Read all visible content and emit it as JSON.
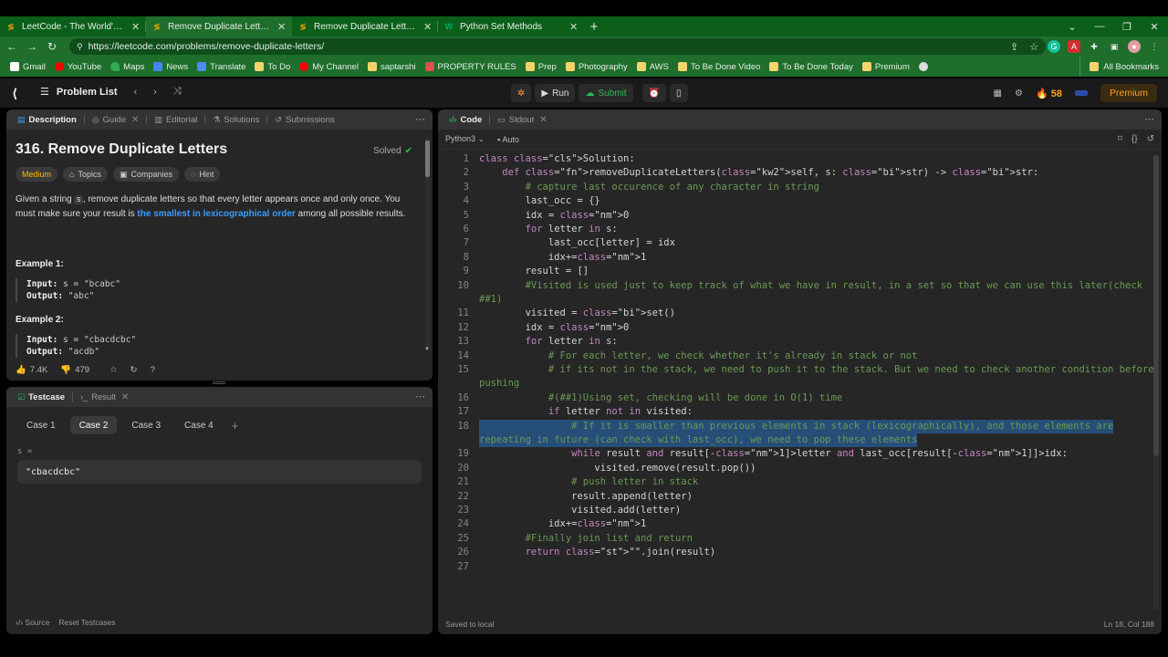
{
  "browser": {
    "tabs": [
      {
        "favicon": "leetcode-favicon",
        "title": "LeetCode - The World's Leading O",
        "active": false
      },
      {
        "favicon": "leetcode-favicon",
        "title": "Remove Duplicate Letters - LeetC",
        "active": true
      },
      {
        "favicon": "leetcode-favicon",
        "title": "Remove Duplicate Letters - LeetC",
        "active": false
      },
      {
        "favicon": "w3schools-favicon",
        "title": "Python Set Methods",
        "active": false
      }
    ],
    "url": "https://leetcode.com/problems/remove-duplicate-letters/",
    "bookmarks": [
      "Gmail",
      "YouTube",
      "Maps",
      "News",
      "Translate",
      "To Do",
      "My Channel",
      "saptarshi",
      "PROPERTY RULES",
      "Prep",
      "Photography",
      "AWS",
      "To Be Done Video",
      "To Be Done Today",
      "Premium"
    ],
    "all_bookmarks": "All Bookmarks"
  },
  "lc_header": {
    "problem_list": "Problem List",
    "run": "Run",
    "submit": "Submit",
    "streak": "58",
    "premium": "Premium"
  },
  "description": {
    "tabs": [
      "Description",
      "Guide",
      "Editorial",
      "Solutions",
      "Submissions"
    ],
    "title": "316. Remove Duplicate Letters",
    "solved": "Solved",
    "tags": [
      "Medium",
      "Topics",
      "Companies",
      "Hint"
    ],
    "prose_1": "Given a string ",
    "prose_code": "s",
    "prose_2": ", remove duplicate letters so that every letter appears once and only once. You must make sure your result is ",
    "prose_hl": "the smallest in lexicographical order",
    "prose_3": " among all possible results.",
    "example1_title": "Example 1:",
    "example1_input_label": "Input:",
    "example1_input": "s = \"bcabc\"",
    "example1_output_label": "Output:",
    "example1_output": "\"abc\"",
    "example2_title": "Example 2:",
    "example2_input_label": "Input:",
    "example2_input": "s = \"cbacdcbc\"",
    "example2_output_label": "Output:",
    "example2_output": "\"acdb\"",
    "likes": "7.4K",
    "dislikes": "479"
  },
  "testcase": {
    "tabs": [
      "Testcase",
      "Result"
    ],
    "cases": [
      "Case 1",
      "Case 2",
      "Case 3",
      "Case 4"
    ],
    "active_case": "Case 2",
    "var_label": "s =",
    "var_value": "\"cbacdcbc\"",
    "source": "Source",
    "reset": "Reset Testcases"
  },
  "code": {
    "tabs": [
      "Code",
      "Stdout"
    ],
    "language": "Python3",
    "auto": "Auto",
    "saved": "Saved to local",
    "position": "Ln 18, Col 188",
    "lines": [
      {
        "n": "1",
        "t": "class Solution:"
      },
      {
        "n": "2",
        "t": "    def removeDuplicateLetters(self, s: str) -> str:"
      },
      {
        "n": "3",
        "t": "        # capture last occurence of any character in string"
      },
      {
        "n": "4",
        "t": "        last_occ = {}"
      },
      {
        "n": "5",
        "t": "        idx = 0"
      },
      {
        "n": "6",
        "t": "        for letter in s:"
      },
      {
        "n": "7",
        "t": "            last_occ[letter] = idx"
      },
      {
        "n": "8",
        "t": "            idx+=1"
      },
      {
        "n": "9",
        "t": "        result = []"
      },
      {
        "n": "10",
        "t": "        #Visited is used just to keep track of what we have in result, in a set so that we can use this later(check"
      },
      {
        "n": "",
        "t": "##1)"
      },
      {
        "n": "11",
        "t": "        visited = set()"
      },
      {
        "n": "12",
        "t": "        idx = 0"
      },
      {
        "n": "13",
        "t": "        for letter in s:"
      },
      {
        "n": "14",
        "t": "            # For each letter, we check whether it's already in stack or not"
      },
      {
        "n": "15",
        "t": "            # if its not in the stack, we need to push it to the stack. But we need to check another condition before"
      },
      {
        "n": "",
        "t": "pushing"
      },
      {
        "n": "16",
        "t": "            #(##1)Using set, checking will be done in O(1) time"
      },
      {
        "n": "17",
        "t": "            if letter not in visited:"
      },
      {
        "n": "18",
        "t": "                # If it is smaller than previous elements in stack (lexicographically), and those elements are"
      },
      {
        "n": "",
        "t": "repeating in future (can check with last_occ), we need to pop these elements"
      },
      {
        "n": "19",
        "t": "                while result and result[-1]>letter and last_occ[result[-1]]>idx:"
      },
      {
        "n": "20",
        "t": "                    visited.remove(result.pop())"
      },
      {
        "n": "21",
        "t": "                # push letter in stack"
      },
      {
        "n": "22",
        "t": "                result.append(letter)"
      },
      {
        "n": "23",
        "t": "                visited.add(letter)"
      },
      {
        "n": "24",
        "t": "            idx+=1"
      },
      {
        "n": "25",
        "t": "        #Finally join list and return"
      },
      {
        "n": "26",
        "t": "        return \"\".join(result)"
      },
      {
        "n": "27",
        "t": ""
      }
    ]
  }
}
